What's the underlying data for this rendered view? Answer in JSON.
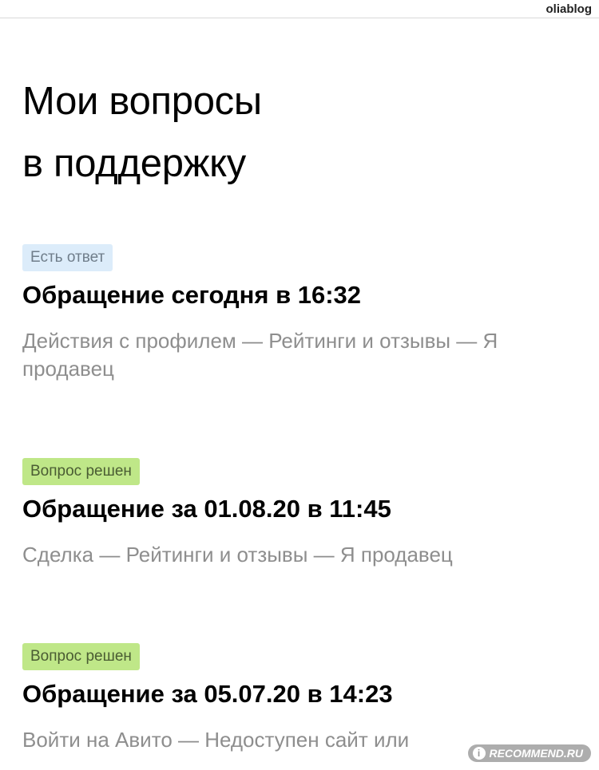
{
  "header": {
    "username": "oliablog"
  },
  "page": {
    "title_line1": "Мои вопросы",
    "title_line2": "в поддержку"
  },
  "tickets": [
    {
      "status": "Есть ответ",
      "title": "Обращение сегодня в 16:32",
      "category": "Действия с профилем — Рейтинги и отзывы — Я продавец"
    },
    {
      "status": "Вопрос решен",
      "title": "Обращение за 01.08.20 в 11:45",
      "category": "Сделка — Рейтинги и отзывы — Я продавец"
    },
    {
      "status": "Вопрос решен",
      "title": "Обращение за 05.07.20 в 14:23",
      "category": "Войти на Авито — Недоступен сайт или"
    }
  ],
  "watermark": {
    "text": "RECOMMEND.RU",
    "icon": "i-logo-icon"
  },
  "colors": {
    "badge_answered_bg": "#dcecfa",
    "badge_resolved_bg": "#bfe788",
    "secondary_text": "#8e8e8e"
  }
}
